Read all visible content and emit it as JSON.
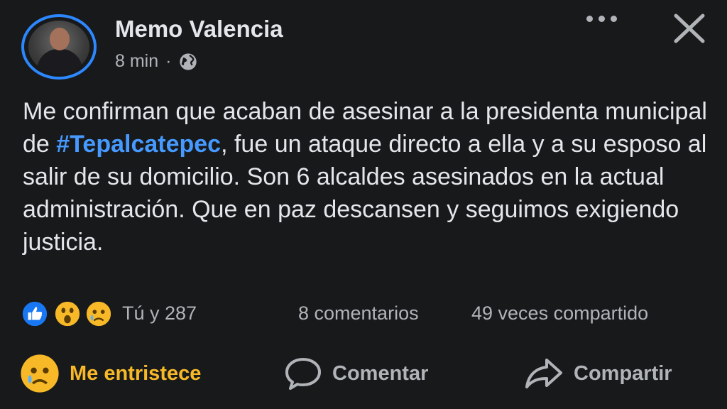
{
  "post": {
    "author": "Memo Valencia",
    "time": "8 min",
    "separator": "·",
    "privacy_icon": "globe-icon",
    "text_before": "Me confirman que acaban de asesinar a la presidenta municipal de ",
    "hashtag": "#Tepalcatepec",
    "text_after": ", fue un ataque directo a ella y a su esposo al salir de su domicilio. Son 6 alcaldes asesinados en la actual administración. Que en paz descansen y seguimos exigiendo justicia."
  },
  "stats": {
    "reaction_icons": [
      "like-icon",
      "wow-icon",
      "sad-icon"
    ],
    "reactions_label": "Tú y 287",
    "comments_label": "8 comentarios",
    "shares_label": "49 veces compartido"
  },
  "actions": {
    "reaction_label": "Me entristece",
    "comment_label": "Comentar",
    "share_label": "Compartir"
  },
  "colors": {
    "background": "#18191a",
    "text": "#e4e6eb",
    "secondary": "#b0b3b8",
    "link": "#4599ff",
    "sad_reaction": "#f7b928",
    "avatar_ring": "#2d88ff"
  }
}
